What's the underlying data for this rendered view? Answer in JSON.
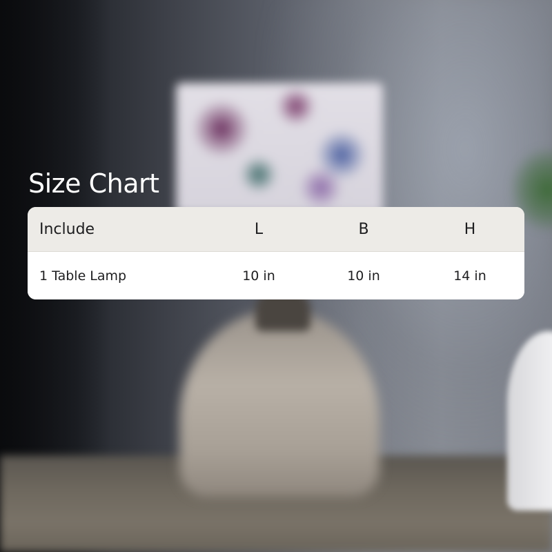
{
  "title": "Size Chart",
  "table": {
    "columns": [
      "Include",
      "L",
      "B",
      "H"
    ],
    "rows": [
      [
        "1 Table Lamp",
        "10 in",
        "10 in",
        "14 in"
      ]
    ]
  },
  "colors": {
    "title_text": "#ffffff",
    "header_bg": "#edebe7",
    "row_bg": "#ffffff",
    "cell_text": "#1d1d1f"
  }
}
